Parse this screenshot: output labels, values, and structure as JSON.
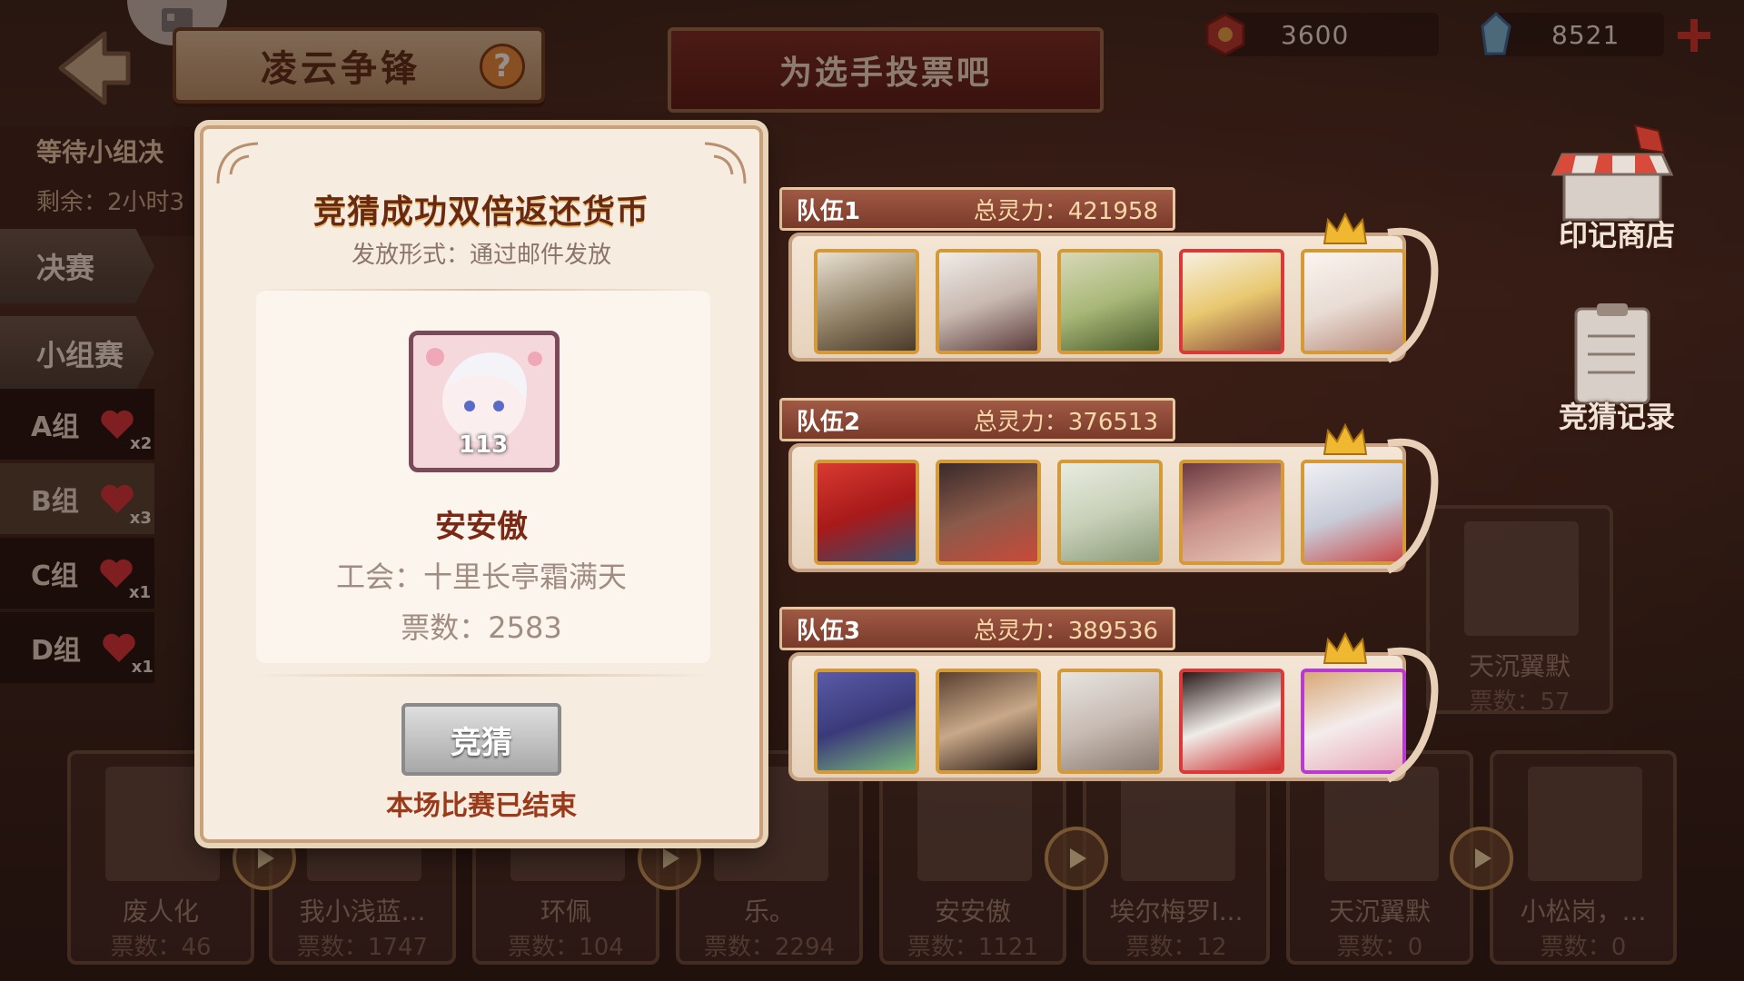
{
  "header": {
    "title": "凌云争锋",
    "banner": "为选手投票吧",
    "currency_1": "3600",
    "currency_2": "8521"
  },
  "left_panel": {
    "status": "等待小组决",
    "remaining": "剩余：2小时3",
    "tab_final": "决赛",
    "tab_group": "小组赛",
    "groups": [
      {
        "label": "A组",
        "count": "x2"
      },
      {
        "label": "B组",
        "count": "x3"
      },
      {
        "label": "C组",
        "count": "x1"
      },
      {
        "label": "D组",
        "count": "x1"
      }
    ]
  },
  "side_buttons": {
    "shop": "印记商店",
    "history": "竞猜记录"
  },
  "teams": [
    {
      "name": "队伍1",
      "power": "总灵力：421958"
    },
    {
      "name": "队伍2",
      "power": "总灵力：376513"
    },
    {
      "name": "队伍3",
      "power": "总灵力：389536"
    }
  ],
  "bracket": [
    {
      "name": "废人化",
      "votes": "票数：46"
    },
    {
      "name": "我小浅蓝...",
      "votes": "票数：1747"
    },
    {
      "name": "环佩",
      "votes": "票数：104"
    },
    {
      "name": "乐。",
      "votes": "票数：2294"
    },
    {
      "name": "安安傲",
      "votes": "票数：1121"
    },
    {
      "name": "埃尔梅罗I...",
      "votes": "票数：12"
    },
    {
      "name": "天沉翼默",
      "votes": "票数：0"
    },
    {
      "name": "小松岗，...",
      "votes": "票数：0"
    }
  ],
  "bracket_side": {
    "name": "天沉翼默",
    "votes": "票数：57"
  },
  "modal": {
    "title": "竞猜成功双倍返还货币",
    "subtitle": "发放形式：通过邮件发放",
    "player_level": "113",
    "player_name": "安安傲",
    "guild": "工会：十里长亭霜满天",
    "votes": "票数：2583",
    "button": "竞猜",
    "status": "本场比赛已结束"
  }
}
